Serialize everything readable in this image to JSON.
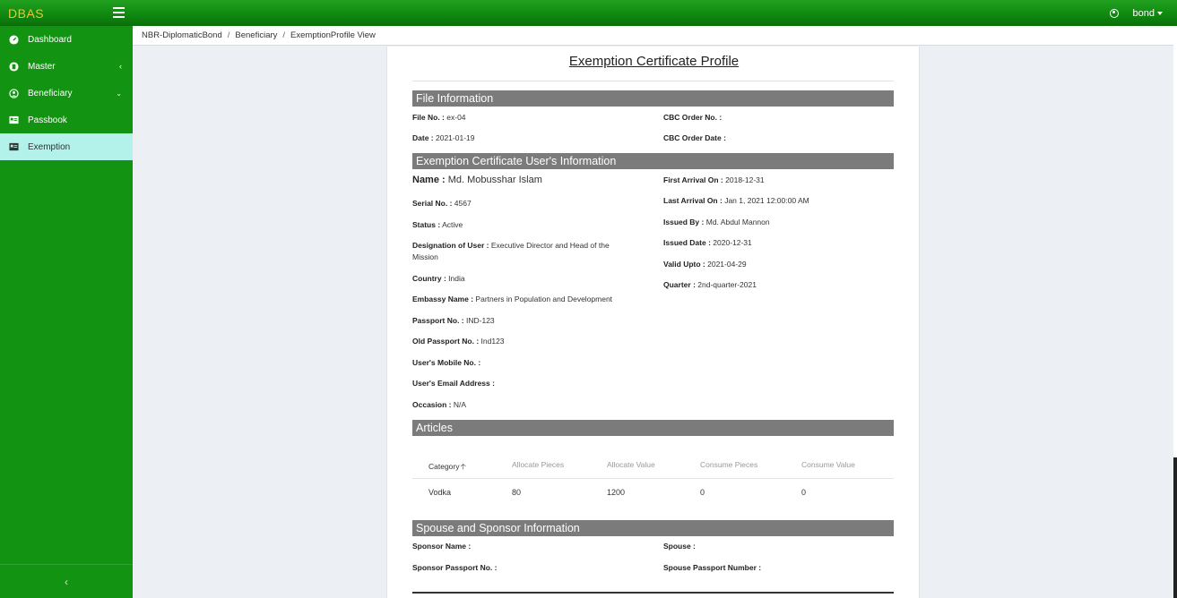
{
  "app": {
    "brand": "DBAS"
  },
  "user": {
    "name": "bond"
  },
  "sidebar": {
    "items": [
      {
        "label": "Dashboard",
        "icon": "dashboard-icon"
      },
      {
        "label": "Master",
        "icon": "master-icon"
      },
      {
        "label": "Beneficiary",
        "icon": "user-circle-icon"
      },
      {
        "label": "Passbook",
        "icon": "card-icon"
      },
      {
        "label": "Exemption",
        "icon": "card-icon"
      }
    ],
    "active_index": 4
  },
  "breadcrumb": [
    "NBR-DiplomaticBond",
    "Beneficiary",
    "ExemptionProfile View"
  ],
  "page": {
    "title": "Exemption Certificate Profile",
    "file_info": {
      "heading": "File Information",
      "file_no_label": "File No. :",
      "file_no": "ex-04",
      "date_label": "Date :",
      "date": "2021-01-19",
      "cbc_order_no_label": "CBC Order No. :",
      "cbc_order_no": "",
      "cbc_order_date_label": "CBC Order Date :",
      "cbc_order_date": ""
    },
    "user_info": {
      "heading": "Exemption Certificate User's Information",
      "name_label": "Name :",
      "name": "Md. Mobusshar Islam",
      "serial_label": "Serial No. :",
      "serial": "4567",
      "status_label": "Status :",
      "status": "Active",
      "designation_label": "Designation of User :",
      "designation": "Executive Director and Head of the",
      "designation_cont": "Mission",
      "country_label": "Country :",
      "country": "India",
      "embassy_label": "Embassy Name :",
      "embassy": "Partners in Population and Development",
      "passport_label": "Passport No. :",
      "passport": "IND-123",
      "old_passport_label": "Old Passport No. :",
      "old_passport": "Ind123",
      "mobile_label": "User's Mobile No. :",
      "mobile": "",
      "email_label": "User's Email Address :",
      "email": "",
      "occasion_label": "Occasion :",
      "occasion": "N/A",
      "first_arrival_label": "First Arrival On :",
      "first_arrival": "2018-12-31",
      "last_arrival_label": "Last Arrival On :",
      "last_arrival": "Jan 1, 2021 12:00:00 AM",
      "issued_by_label": "Issued By :",
      "issued_by": "Md. Abdul Mannon",
      "issued_date_label": "Issued Date :",
      "issued_date": "2020-12-31",
      "valid_upto_label": "Valid Upto :",
      "valid_upto": "2021-04-29",
      "quarter_label": "Quarter :",
      "quarter": "2nd-quarter-2021"
    },
    "articles": {
      "heading": "Articles",
      "columns": [
        "Category",
        "Allocate Pieces",
        "Allocate Value",
        "Consume Pieces",
        "Consume Value"
      ],
      "rows": [
        [
          "Vodka",
          "80",
          "1200",
          "0",
          "0"
        ]
      ]
    },
    "spouse_info": {
      "heading": "Spouse and Sponsor Information",
      "sponsor_name_label": "Sponsor Name :",
      "sponsor_name": "",
      "sponsor_passport_label": "Sponsor Passport No. :",
      "sponsor_passport": "",
      "spouse_label": "Spouse :",
      "spouse": "",
      "spouse_passport_label": "Spouse Passport Number :",
      "spouse_passport": ""
    }
  }
}
